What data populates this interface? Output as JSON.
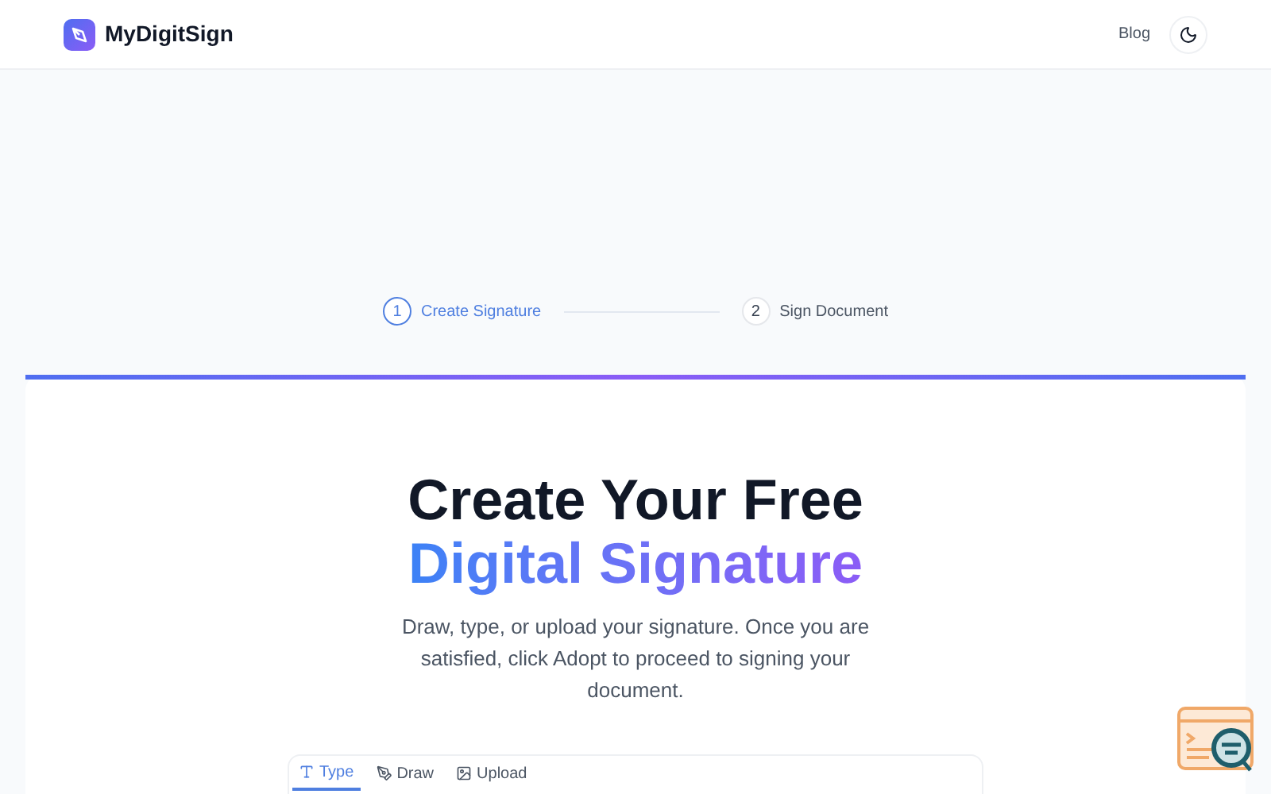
{
  "header": {
    "brand": "MyDigitSign",
    "nav": [
      "Blog"
    ]
  },
  "steps": [
    {
      "number": "1",
      "label": "Create Signature",
      "selected": true
    },
    {
      "number": "2",
      "label": "Sign Document",
      "selected": false
    }
  ],
  "hero": {
    "title_line_1": "Create Your Free",
    "title_line_2": "Digital Signature",
    "description": "Draw, type, or upload your signature. Once you are satisfied, click Adopt to proceed to signing your document."
  },
  "tabs": [
    {
      "kind": "type",
      "label": "Type",
      "selected": true
    },
    {
      "kind": "draw",
      "label": "Draw",
      "selected": false
    },
    {
      "kind": "upload",
      "label": "Upload",
      "selected": false
    }
  ]
}
